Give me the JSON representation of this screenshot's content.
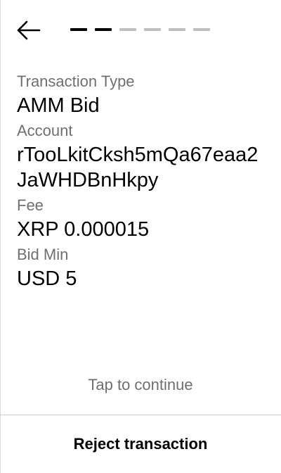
{
  "header": {
    "back_icon": "arrow-left-icon",
    "progress": {
      "total_steps": 6,
      "active_steps": 2
    }
  },
  "fields": [
    {
      "label": "Transaction Type",
      "value": "AMM Bid"
    },
    {
      "label": "Account",
      "value": "rTooLkitCksh5mQa67eaa2JaWHDBnHkpy"
    },
    {
      "label": "Fee",
      "value": "XRP 0.000015"
    },
    {
      "label": "Bid Min",
      "value": "USD 5"
    }
  ],
  "footer": {
    "tap_to_continue": "Tap to continue",
    "reject_label": "Reject transaction"
  },
  "colors": {
    "label_text": "#6f6f6f",
    "value_text": "#000000",
    "active_step": "#000000",
    "inactive_step": "#bfbfbf"
  }
}
